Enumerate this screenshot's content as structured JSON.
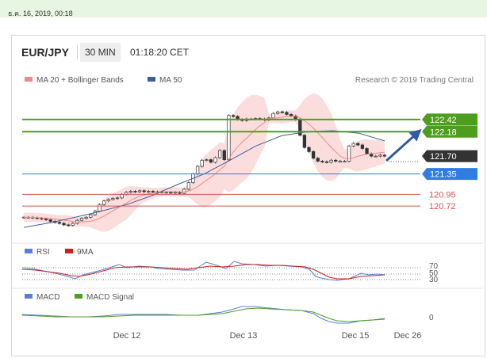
{
  "timestamp": "ธ.ค. 16, 2019, 00:18",
  "header": {
    "symbol": "EUR/JPY",
    "timeframe": "30 MIN",
    "time": "01:18:20 CET"
  },
  "legend": {
    "ma20": "MA 20 + Bollinger Bands",
    "ma50": "MA 50",
    "credit": "Research © 2019 Trading Central"
  },
  "colors": {
    "green": "#4d9e1c",
    "blue": "#2f7de0",
    "red": "#d9534f",
    "pink_band": "#fbd5d5",
    "ma20": "#ef8a8a",
    "ma50": "#3d5f99",
    "arrow": "#2e5aa8",
    "dark_label": "#333333"
  },
  "chart_data": [
    {
      "type": "candlestick",
      "title": "EUR/JPY 30 MIN",
      "x_ticks": [
        "Dec 12",
        "Dec 13",
        "Dec 15",
        "Dec 26"
      ],
      "levels": [
        {
          "value": 122.42,
          "label": "122.42",
          "kind": "resistance",
          "color": "#4d9e1c"
        },
        {
          "value": 122.18,
          "label": "122.18",
          "kind": "resistance",
          "color": "#4d9e1c"
        },
        {
          "value": 121.7,
          "label": "121.70",
          "kind": "last_price",
          "color": "#333333"
        },
        {
          "value": 121.35,
          "label": "121.35",
          "kind": "pivot",
          "color": "#2f7de0"
        },
        {
          "value": 120.95,
          "label": "120.95",
          "kind": "support",
          "color": "#d9534f"
        },
        {
          "value": 120.72,
          "label": "120.72",
          "kind": "support",
          "color": "#d9534f"
        }
      ],
      "close": [
        120.5,
        120.5,
        120.49,
        120.48,
        120.47,
        120.45,
        120.42,
        120.4,
        120.38,
        120.35,
        120.34,
        120.38,
        120.44,
        120.48,
        120.5,
        120.55,
        120.62,
        120.75,
        120.82,
        120.85,
        120.87,
        120.88,
        120.95,
        120.99,
        121.01,
        121.0,
        121.02,
        121.0,
        121.01,
        121.0,
        121.0,
        120.99,
        120.99,
        120.98,
        120.99,
        120.97,
        121.05,
        121.18,
        121.35,
        121.5,
        121.62,
        121.63,
        121.58,
        121.67,
        121.81,
        121.63,
        122.5,
        122.48,
        122.42,
        122.4,
        122.43,
        122.43,
        122.44,
        122.43,
        122.41,
        122.45,
        122.54,
        122.57,
        122.56,
        122.52,
        122.49,
        122.42,
        122.11,
        121.87,
        121.79,
        121.66,
        121.6,
        121.59,
        121.58,
        121.62,
        121.6,
        121.6,
        121.6,
        121.9,
        121.95,
        121.92,
        121.85,
        121.75,
        121.7,
        121.7,
        121.72,
        121.7
      ],
      "ma50": [
        120.3,
        120.39,
        120.5,
        120.62,
        120.75,
        120.93,
        121.15,
        121.35,
        121.62,
        121.9,
        122.1,
        122.18,
        122.2,
        122.15,
        122.0
      ],
      "ylim": [
        120.1,
        122.9
      ]
    },
    {
      "type": "line",
      "title": "RSI",
      "series": [
        {
          "name": "RSI"
        },
        {
          "name": "9MA"
        }
      ],
      "levels": [
        70,
        50,
        30
      ],
      "ylim": [
        20,
        80
      ]
    },
    {
      "type": "line",
      "title": "MACD",
      "series": [
        {
          "name": "MACD"
        },
        {
          "name": "MACD Signal"
        }
      ],
      "levels": [
        0
      ]
    }
  ]
}
